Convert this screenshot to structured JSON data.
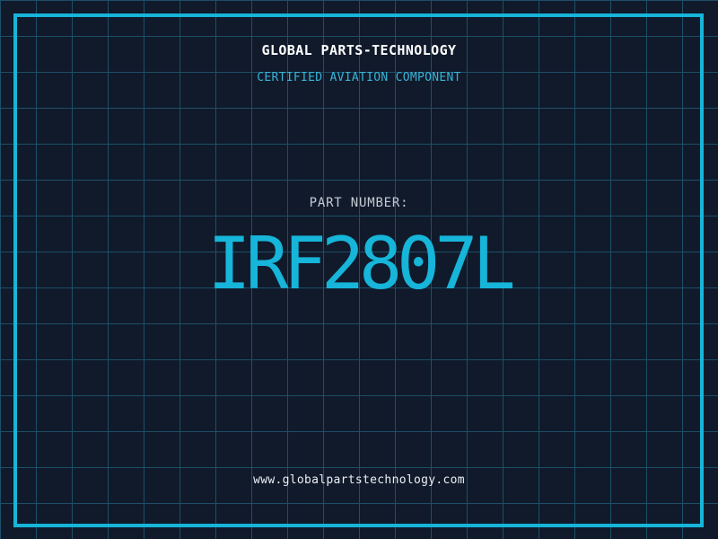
{
  "header": {
    "title": "GLOBAL PARTS-TECHNOLOGY",
    "subtitle": "CERTIFIED AVIATION COMPONENT"
  },
  "part": {
    "label": "PART NUMBER:",
    "value": "IRF2807L"
  },
  "footer": {
    "url": "www.globalpartstechnology.com"
  },
  "colors": {
    "background": "#101A2B",
    "grid_line": "#1D4F66",
    "frame_accent": "#16B5D9",
    "title_text": "#FFFFFF",
    "subtitle_text": "#38B4D8",
    "part_label_text": "#C6CBD4",
    "part_value_text": "#16B5D9",
    "url_text": "#ECF0F4"
  }
}
